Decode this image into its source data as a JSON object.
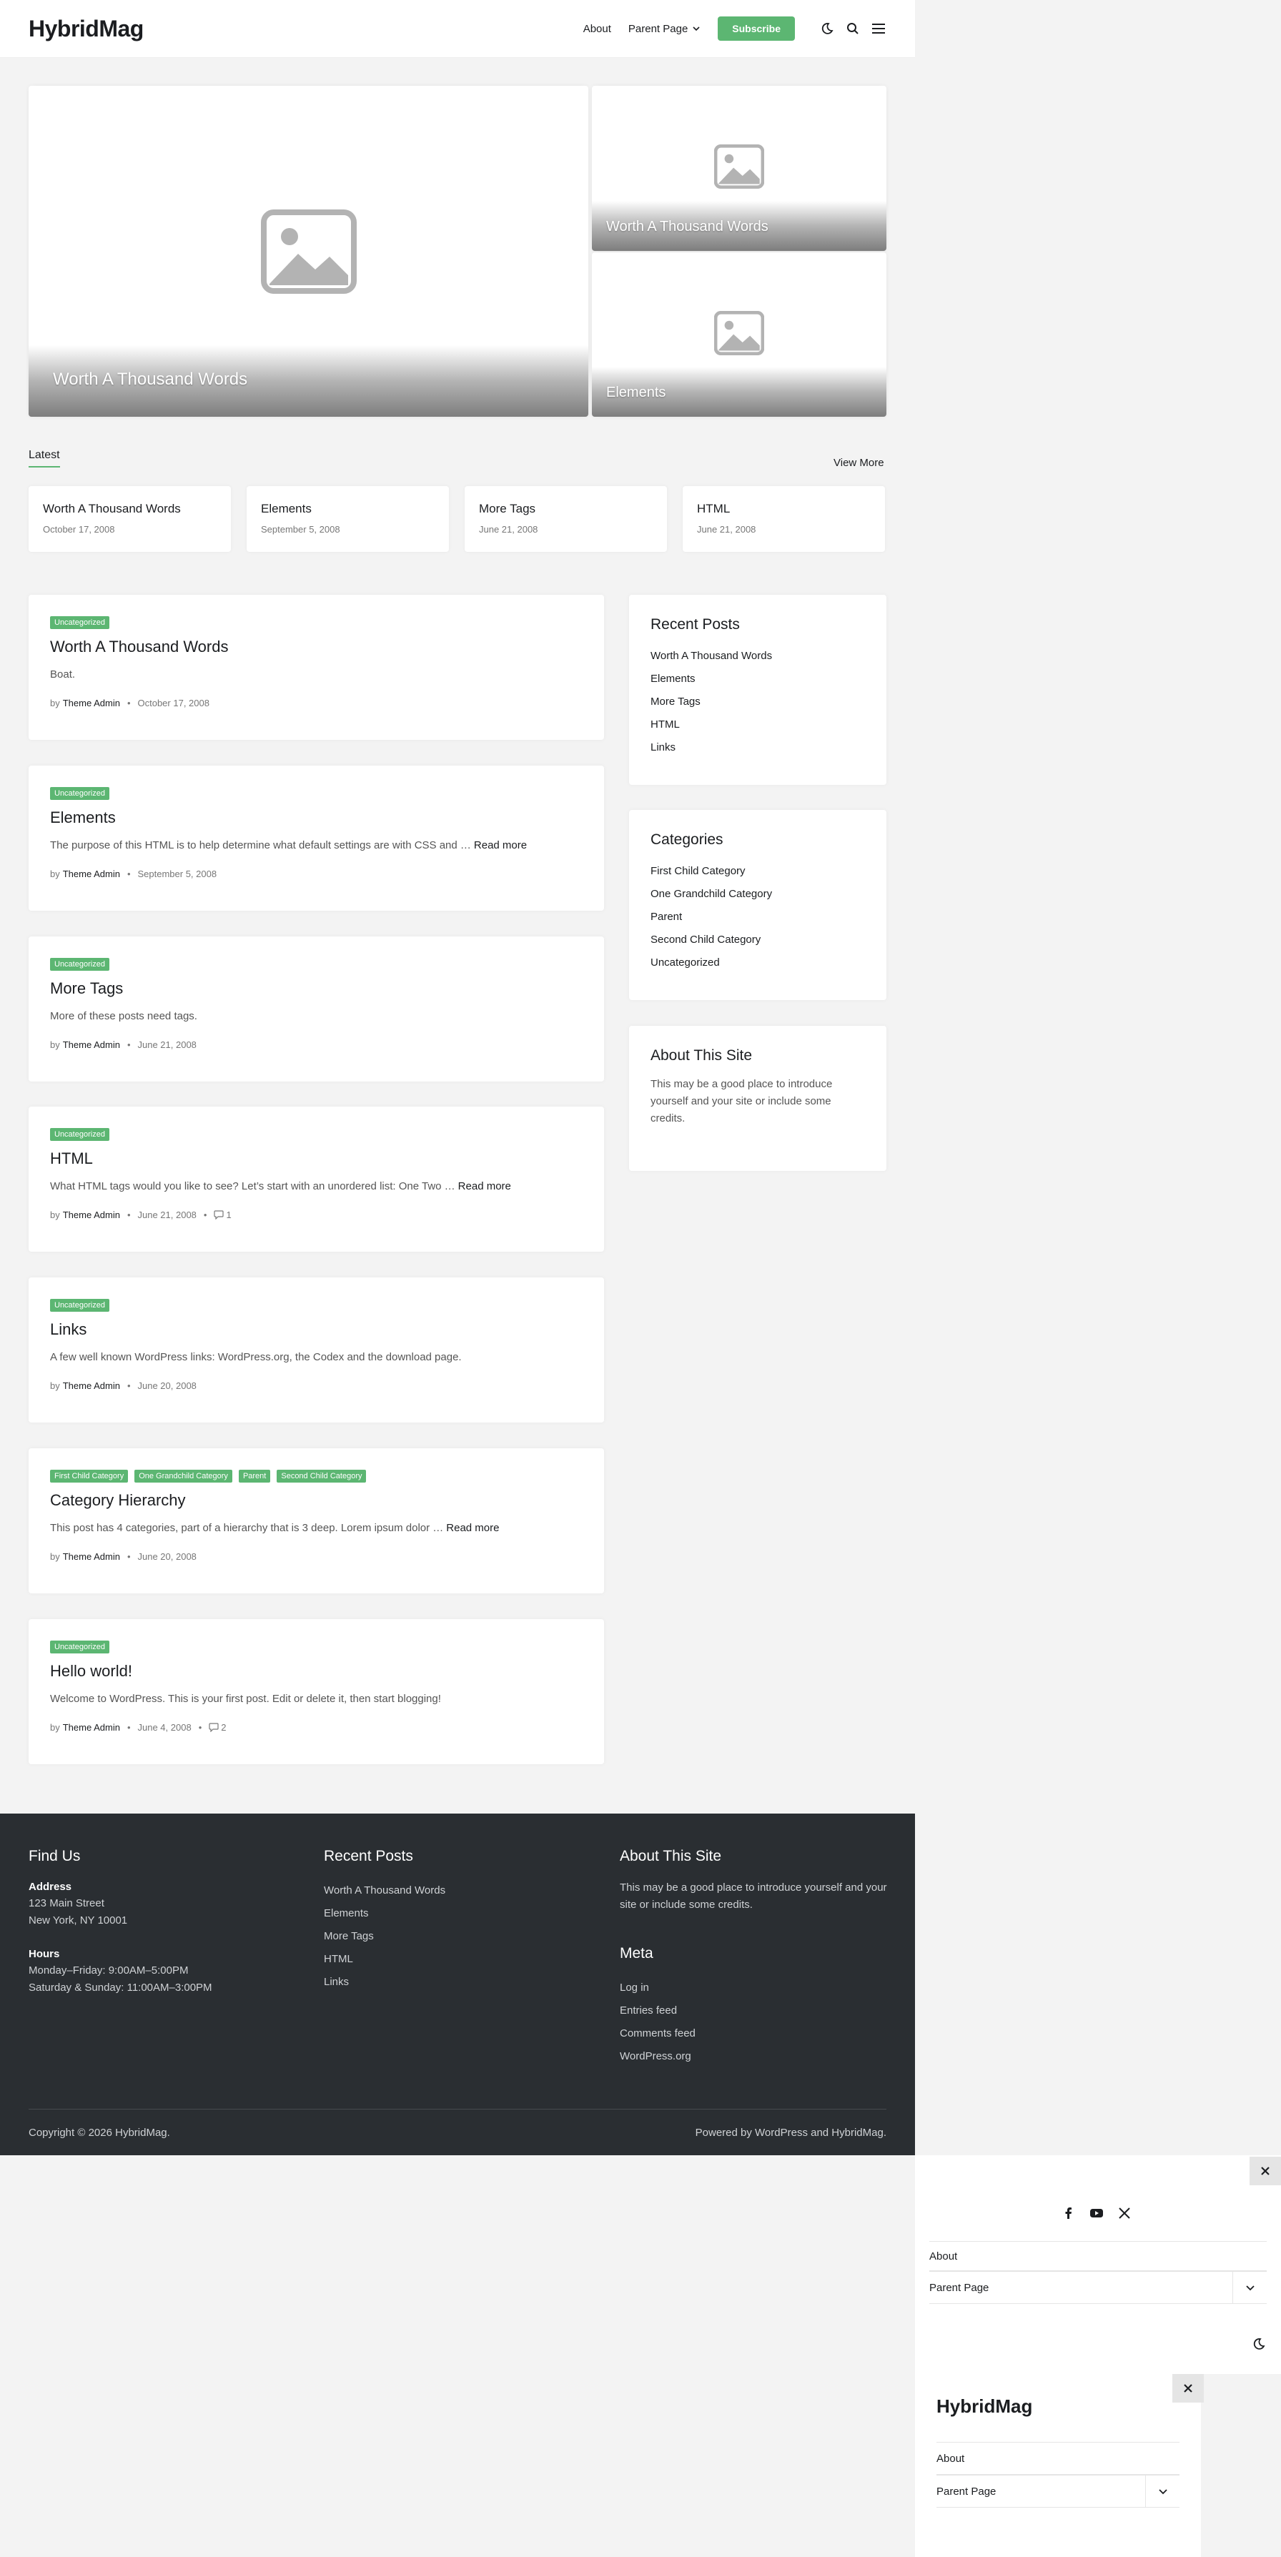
{
  "header": {
    "logo": "HybridMag",
    "nav": [
      {
        "label": "About"
      },
      {
        "label": "Parent Page"
      }
    ],
    "subscribe": "Subscribe"
  },
  "hero": {
    "main": {
      "title": "Worth A Thousand Words"
    },
    "side": [
      {
        "title": "Worth A Thousand Words"
      },
      {
        "title": "Elements"
      }
    ]
  },
  "latest": {
    "label": "Latest",
    "view_more": "View More",
    "items": [
      {
        "title": "Worth A Thousand Words",
        "date": "October 17, 2008"
      },
      {
        "title": "Elements",
        "date": "September 5, 2008"
      },
      {
        "title": "More Tags",
        "date": "June 21, 2008"
      },
      {
        "title": "HTML",
        "date": "June 21, 2008"
      }
    ]
  },
  "posts": [
    {
      "tags": [
        "Uncategorized"
      ],
      "title": "Worth A Thousand Words",
      "excerpt": "Boat.",
      "read_more": "",
      "by": "by",
      "author": "Theme Admin",
      "date": "October 17, 2008",
      "comments": ""
    },
    {
      "tags": [
        "Uncategorized"
      ],
      "title": "Elements",
      "excerpt": "The purpose of this HTML is to help determine what default settings are with CSS and …",
      "read_more": "Read more",
      "by": "by",
      "author": "Theme Admin",
      "date": "September 5, 2008",
      "comments": ""
    },
    {
      "tags": [
        "Uncategorized"
      ],
      "title": "More Tags",
      "excerpt": "More of these posts need tags.",
      "read_more": "",
      "by": "by",
      "author": "Theme Admin",
      "date": "June 21, 2008",
      "comments": ""
    },
    {
      "tags": [
        "Uncategorized"
      ],
      "title": "HTML",
      "excerpt": "What HTML tags would you like to see? Let’s start with an unordered list: One Two …",
      "read_more": "Read more",
      "by": "by",
      "author": "Theme Admin",
      "date": "June 21, 2008",
      "comments": "1"
    },
    {
      "tags": [
        "Uncategorized"
      ],
      "title": "Links",
      "excerpt": "A few well known WordPress links: WordPress.org, the Codex and the download page.",
      "read_more": "",
      "by": "by",
      "author": "Theme Admin",
      "date": "June 20, 2008",
      "comments": ""
    },
    {
      "tags": [
        "First Child Category",
        "One Grandchild Category",
        "Parent",
        "Second Child Category"
      ],
      "title": "Category Hierarchy",
      "excerpt": "This post has 4 categories, part of a hierarchy that is 3 deep. Lorem ipsum dolor …",
      "read_more": "Read more",
      "by": "by",
      "author": "Theme Admin",
      "date": "June 20, 2008",
      "comments": ""
    },
    {
      "tags": [
        "Uncategorized"
      ],
      "title": "Hello world!",
      "excerpt": "Welcome to WordPress. This is your first post. Edit or delete it, then start blogging!",
      "read_more": "",
      "by": "by",
      "author": "Theme Admin",
      "date": "June 4, 2008",
      "comments": "2"
    }
  ],
  "sidebar": {
    "recent": {
      "title": "Recent Posts",
      "items": [
        "Worth A Thousand Words",
        "Elements",
        "More Tags",
        "HTML",
        "Links"
      ]
    },
    "categories": {
      "title": "Categories",
      "items": [
        "First Child Category",
        "One Grandchild Category",
        "Parent",
        "Second Child Category",
        "Uncategorized"
      ]
    },
    "about": {
      "title": "About This Site",
      "text": "This may be a good place to introduce yourself and your site or include some credits."
    }
  },
  "footer": {
    "find_us": {
      "title": "Find Us",
      "address_label": "Address",
      "address_line1": "123 Main Street",
      "address_line2": "New York, NY 10001",
      "hours_label": "Hours",
      "hours_line1": "Monday–Friday: 9:00AM–5:00PM",
      "hours_line2": "Saturday & Sunday: 11:00AM–3:00PM"
    },
    "recent": {
      "title": "Recent Posts",
      "items": [
        "Worth A Thousand Words",
        "Elements",
        "More Tags",
        "HTML",
        "Links"
      ]
    },
    "about": {
      "title": "About This Site",
      "text": "This may be a good place to introduce yourself and your site or include some credits."
    },
    "meta": {
      "title": "Meta",
      "items": [
        "Log in",
        "Entries feed",
        "Comments feed",
        "WordPress.org"
      ]
    },
    "copyright": "Copyright © 2026 HybridMag.",
    "powered": "Powered by WordPress and HybridMag."
  },
  "mobile_menu": {
    "items": [
      "About",
      "Parent Page"
    ],
    "social": [
      "facebook-icon",
      "youtube-icon",
      "x-icon"
    ]
  },
  "mobile_menu2": {
    "logo": "HybridMag",
    "items": [
      "About",
      "Parent Page"
    ]
  },
  "colors": {
    "accent": "#5cb672",
    "footer_bg": "#2a2e32",
    "page_bg": "#f3f3f3"
  }
}
